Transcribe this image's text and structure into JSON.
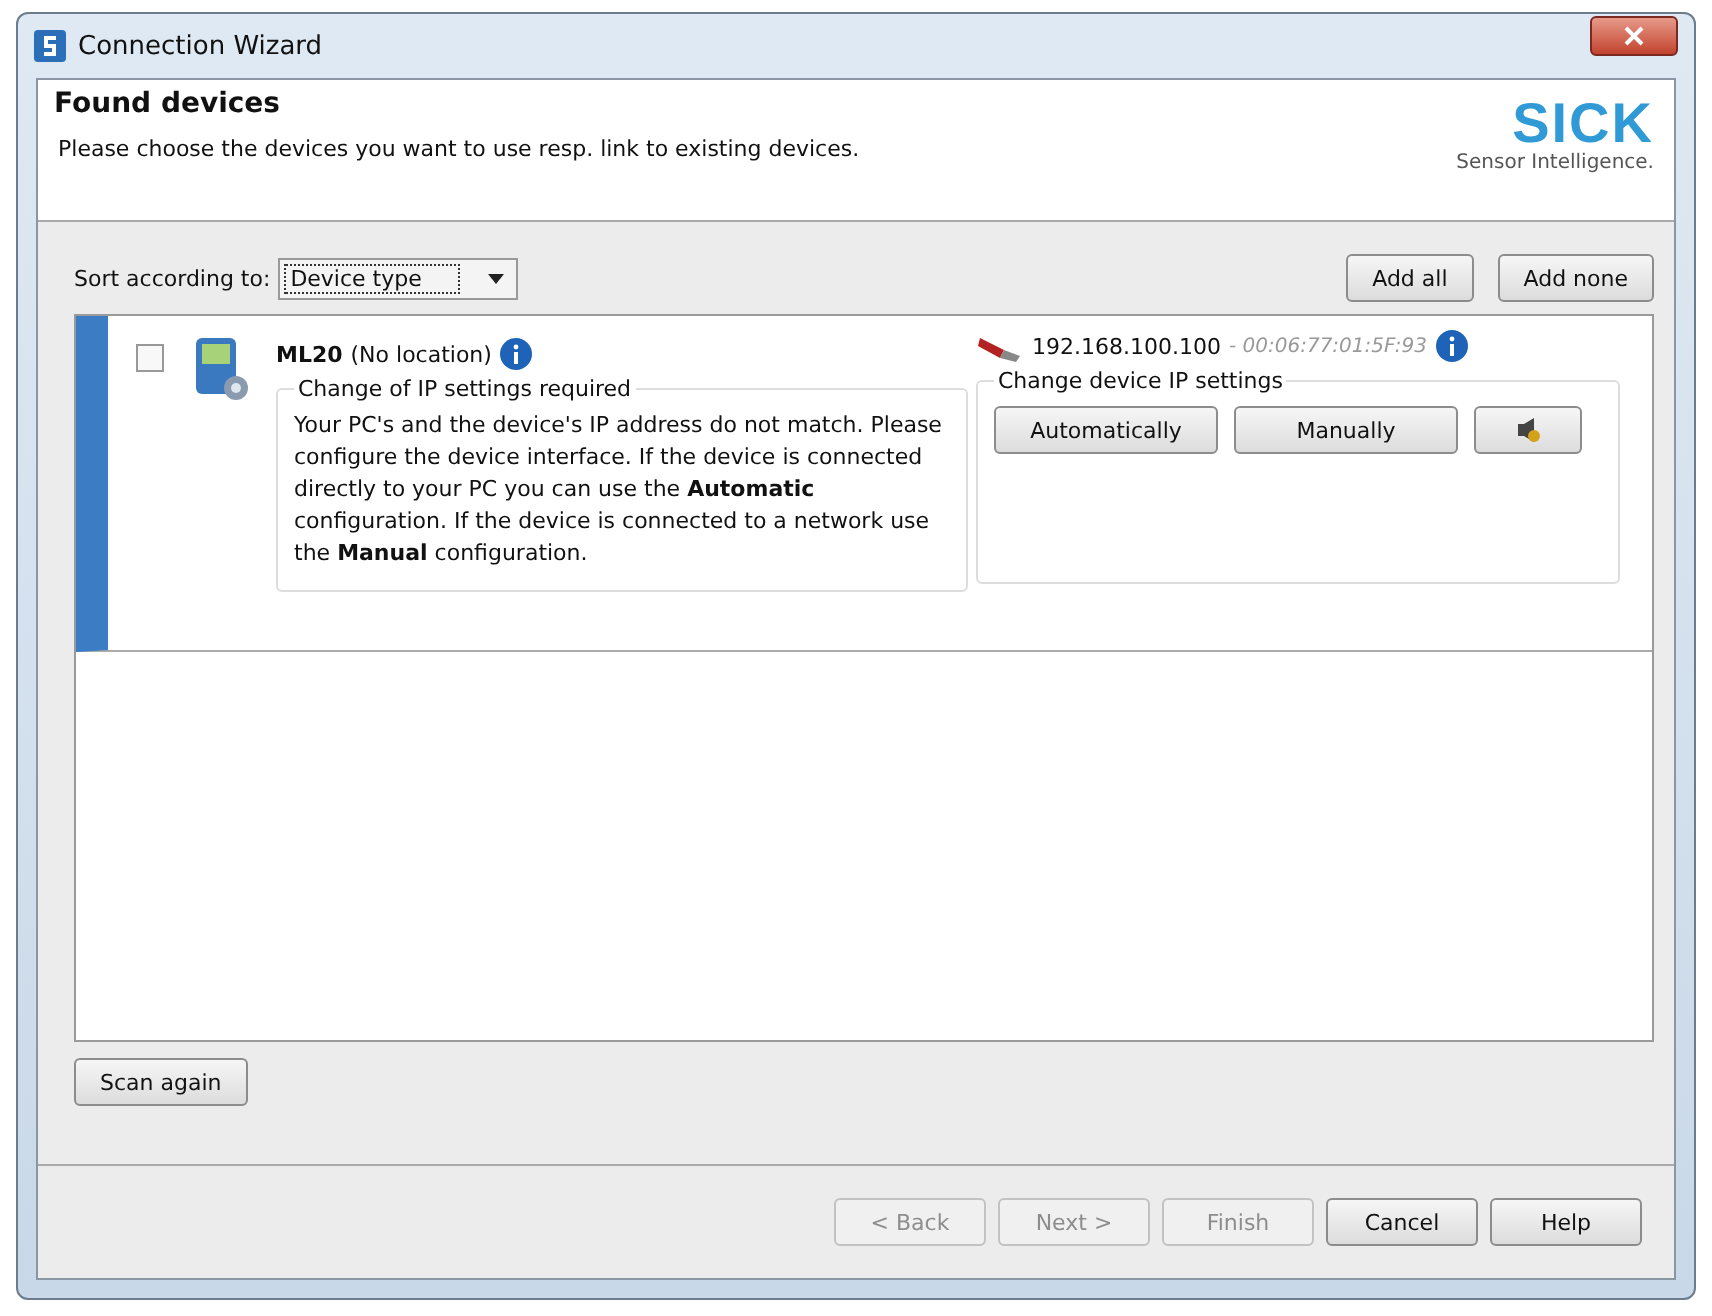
{
  "window": {
    "title": "Connection Wizard"
  },
  "header": {
    "title": "Found devices",
    "subtitle": "Please choose the devices you want to use resp. link to existing devices.",
    "logo": "SICK",
    "tagline": "Sensor Intelligence."
  },
  "sort": {
    "label": "Sort according to:",
    "value": "Device type"
  },
  "list_buttons": [
    "Add all",
    "Add none"
  ],
  "devices": [
    {
      "name": "ML20",
      "location": "(No location)",
      "checked": false,
      "selected": true,
      "ip": "192.168.100.100",
      "mac": "- 00:06:77:01:5F:93",
      "notice_title": "Change of IP settings required",
      "notice": "Your PC's and the device's IP address do not match. Please configure the device interface. If the device is connected directly to your PC you can use the **Automatic** configuration. If the device is connected to a network use the **Manual** configuration.",
      "settings_title": "Change device IP settings",
      "settings_buttons": [
        "Automatically",
        "Manually"
      ]
    }
  ],
  "scan_button": "Scan again",
  "footer_buttons": [
    {
      "label": "< Back",
      "disabled": true
    },
    {
      "label": "Next >",
      "disabled": true
    },
    {
      "label": "Finish",
      "disabled": true
    },
    {
      "label": "Cancel",
      "disabled": false
    },
    {
      "label": "Help",
      "disabled": false
    }
  ]
}
